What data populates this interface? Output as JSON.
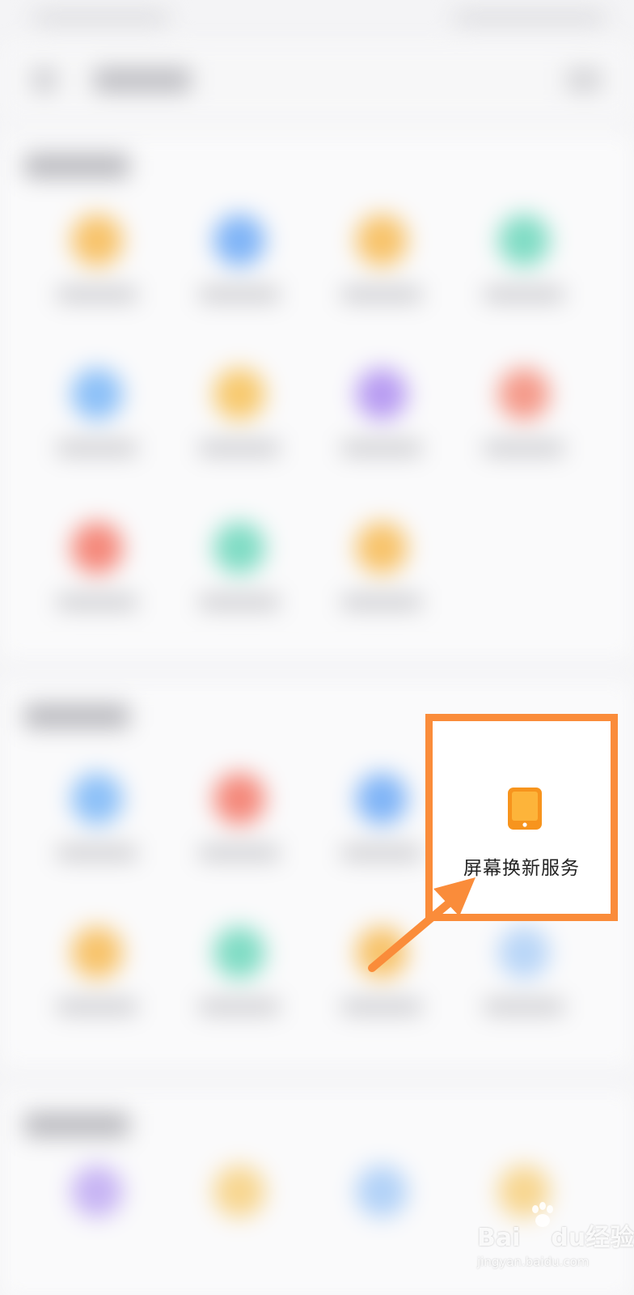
{
  "highlight": {
    "label": "屏幕换新服务",
    "icon": "tablet-icon",
    "border_color": "#fa8c3a",
    "icon_color": "#f7941d"
  },
  "watermark": {
    "brand_a": "Bai",
    "brand_b": "du",
    "brand_c": "经验",
    "domain": "jingyan.baidu.com"
  },
  "blurred_icon_colors": [
    "#f8c36a",
    "#7fb4f7",
    "#f8c36a",
    "#7fdcc4",
    "#8cc0f8",
    "#f8c96e",
    "#b89cf2",
    "#f59a8a",
    "#f5887a",
    "#7fdcc4",
    "#f8c36a",
    "#8cc0f8",
    "#f5887a",
    "#7fb4f7",
    "#f8c36a",
    "#7fdcc4",
    "#f8c36a",
    "#b9d6f8",
    "#c7b4f4",
    "#f8d690",
    "#b2d2f8",
    "#f8d690"
  ]
}
